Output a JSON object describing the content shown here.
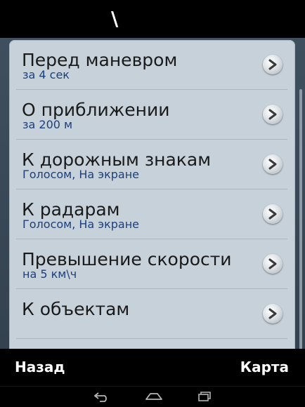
{
  "header": {
    "glyph": "\\"
  },
  "list": {
    "items": [
      {
        "title": "Перед маневром",
        "subtitle": "за 4 сек",
        "icon": "chevron-right-icon"
      },
      {
        "title": "О приближении",
        "subtitle": "за 200 м",
        "icon": "chevron-right-icon"
      },
      {
        "title": "К дорожным знакам",
        "subtitle": "Голосом, На экране",
        "icon": "chevron-right-icon"
      },
      {
        "title": "К радарам",
        "subtitle": "Голосом, На экране",
        "icon": "chevron-right-icon"
      },
      {
        "title": "Превышение скорости",
        "subtitle": "на 5 км\\ч",
        "icon": "chevron-right-icon"
      },
      {
        "title": "К объектам",
        "subtitle": "",
        "icon": "chevron-right-icon"
      }
    ]
  },
  "bottom_bar": {
    "back_label": "Назад",
    "map_label": "Карта"
  },
  "nav_bar": {
    "icons": [
      "back-icon",
      "home-icon",
      "recent-apps-icon"
    ]
  },
  "colors": {
    "panel": "#c6d1da",
    "subtitle": "#1d3f7a",
    "background": "#3f4f5e"
  }
}
